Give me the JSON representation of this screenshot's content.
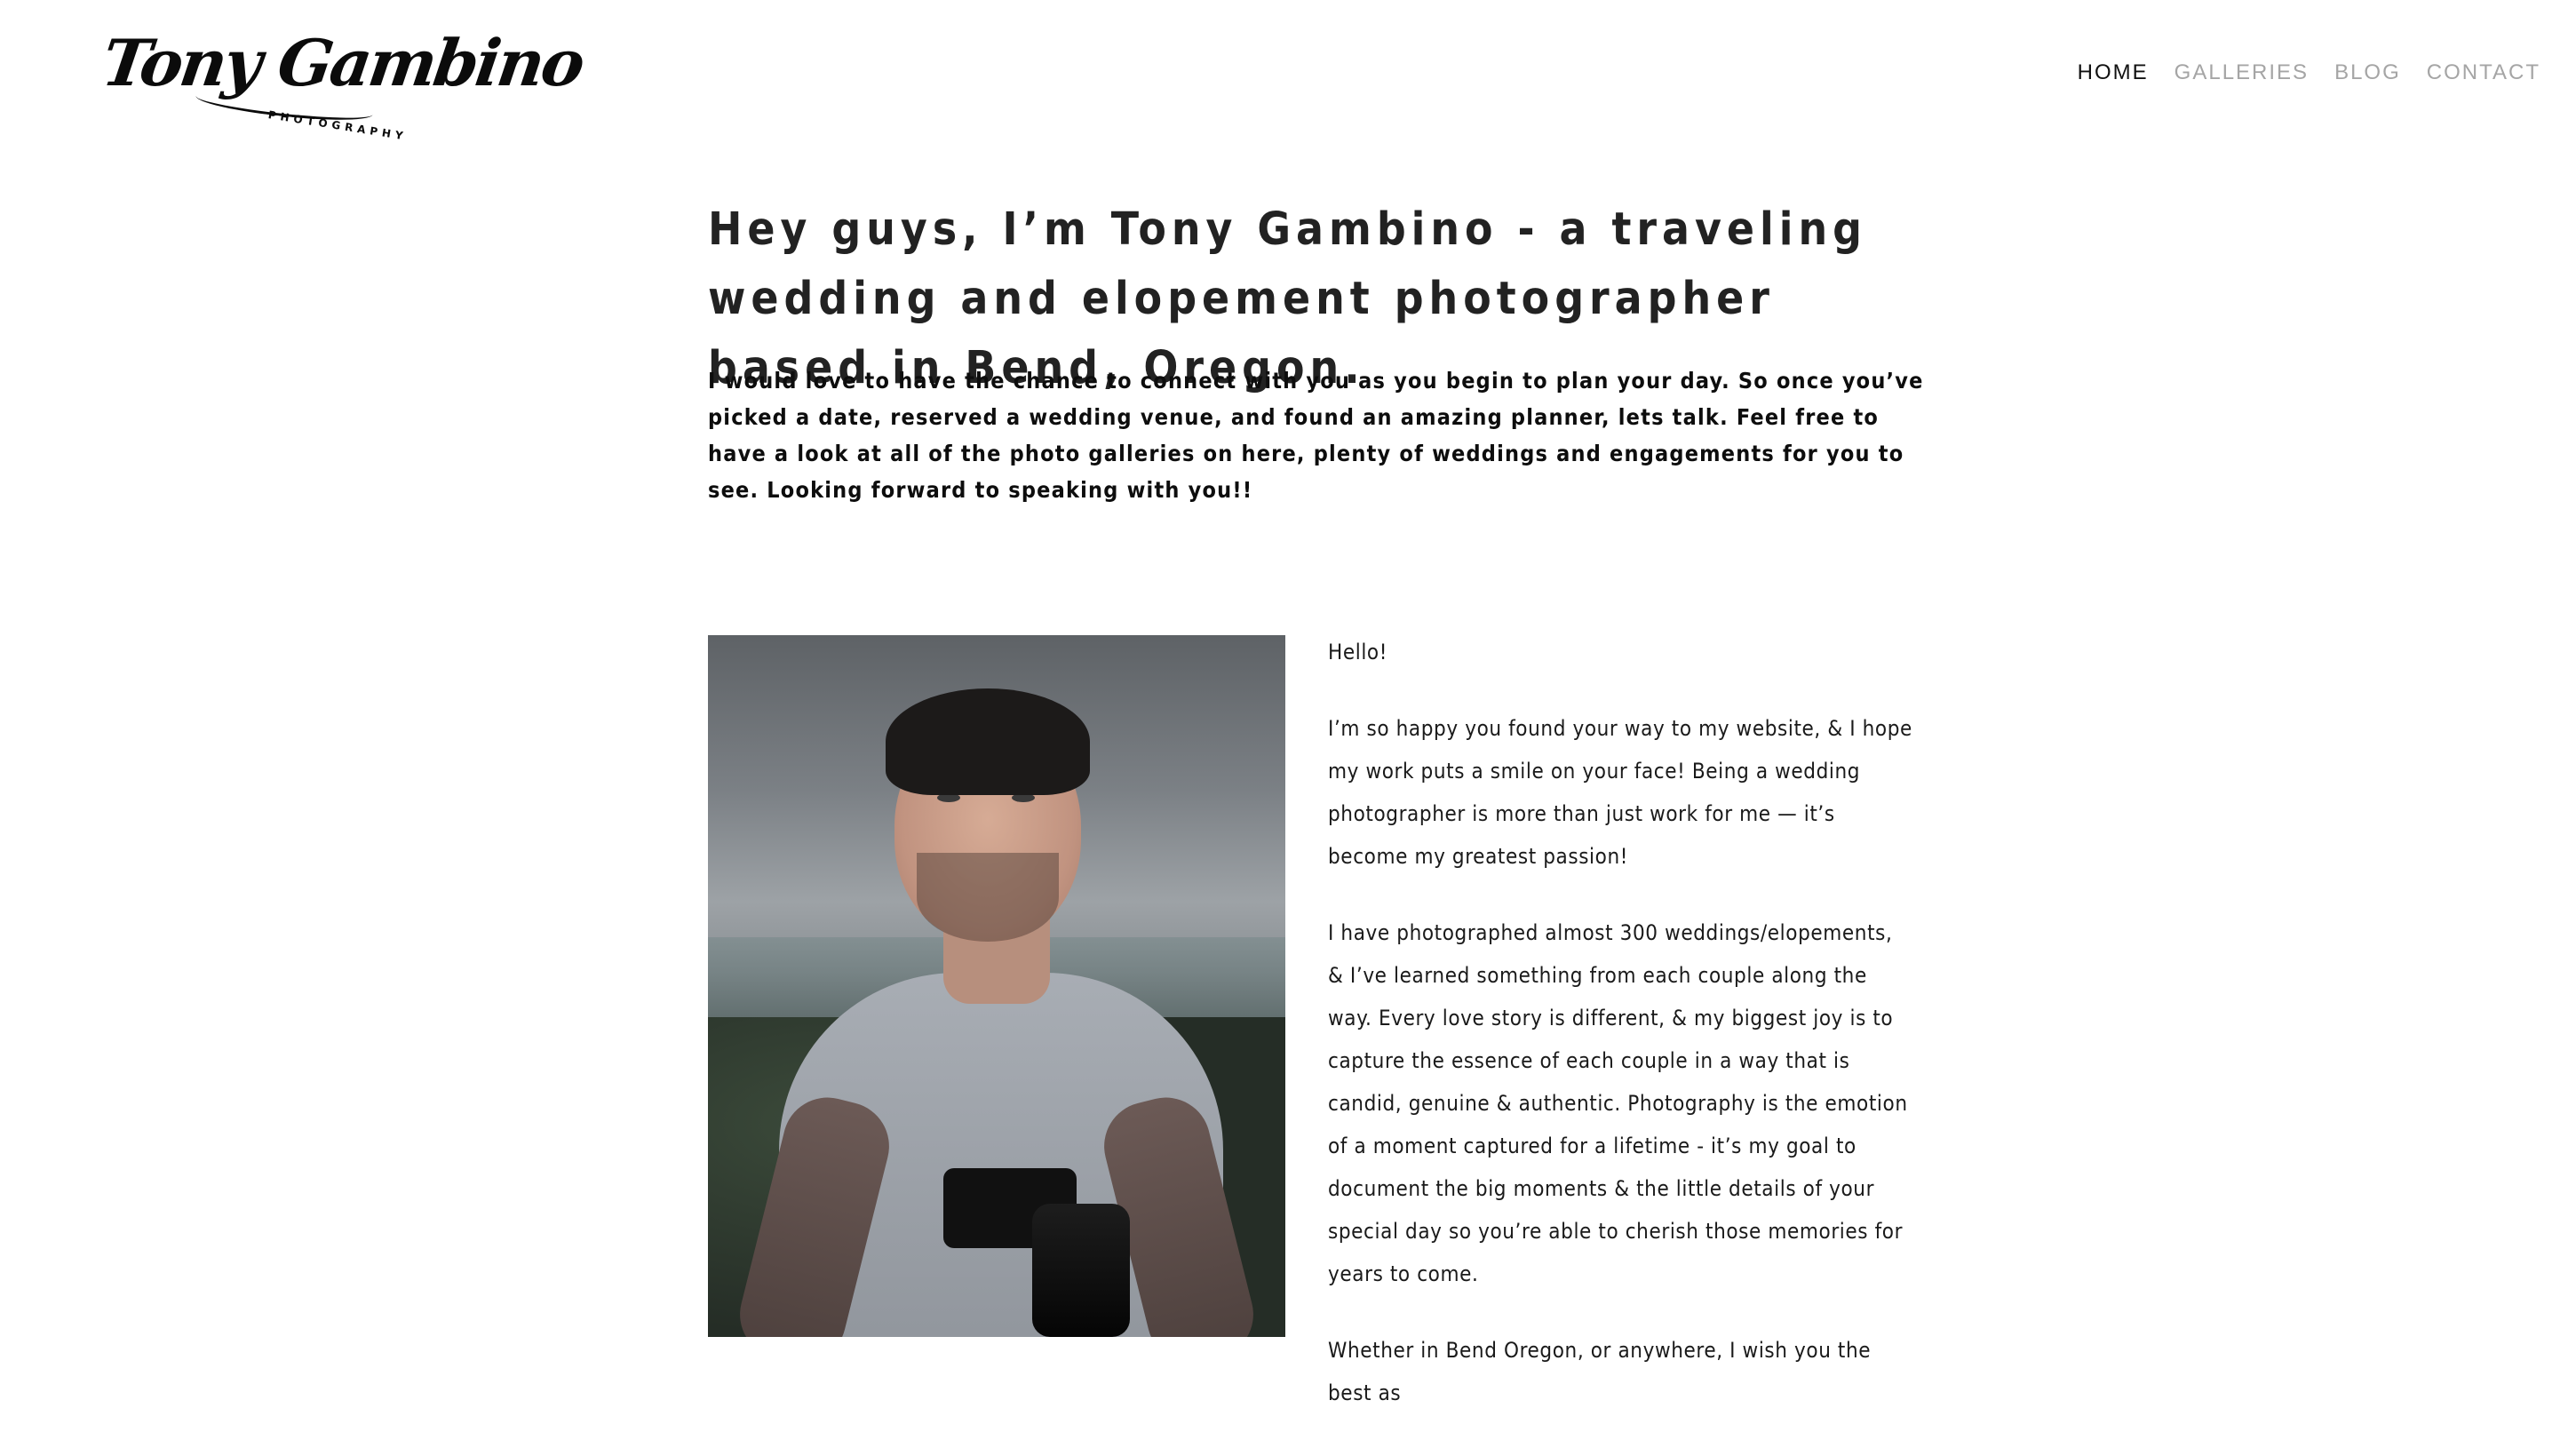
{
  "header": {
    "logo_script": "Tony Gambino",
    "logo_sub": "PHOTOGRAPHY",
    "nav": [
      {
        "label": "HOME"
      },
      {
        "label": "GALLERIES"
      },
      {
        "label": "BLOG"
      },
      {
        "label": "CONTACT"
      }
    ],
    "active": "HOME"
  },
  "intro": {
    "heading": "Hey guys, I’m Tony Gambino - a traveling wedding and elopement photographer based in Bend, Oregon.",
    "text": "I would love to have the chance to connect with you as you begin to plan your day. So once you’ve picked a date, reserved a wedding venue, and found an amazing planner, lets talk. Feel free to have a look at all of the photo galleries on here, plenty of weddings and engagements for you to see. Looking forward to speaking with you!!"
  },
  "bio": {
    "greeting": "Hello!",
    "p1": "I’m so happy you found your way to my website, & I hope my work puts a smile on your face! Being a wedding photographer is more than just work for me — it’s become my greatest passion!",
    "p2": "I have photographed almost 300 weddings/elopements, & I’ve learned something from each couple along the way. Every love story is different, & my biggest joy is to capture the essence of each couple in a way that is candid, genuine & authentic. Photography is the emotion of a moment captured for a lifetime - it’s my goal to document the big moments & the little details of your special day so you’re able to cherish those memories for years to come.",
    "p3": "Whether in Bend Oregon, or anywhere, I wish you the best as"
  }
}
